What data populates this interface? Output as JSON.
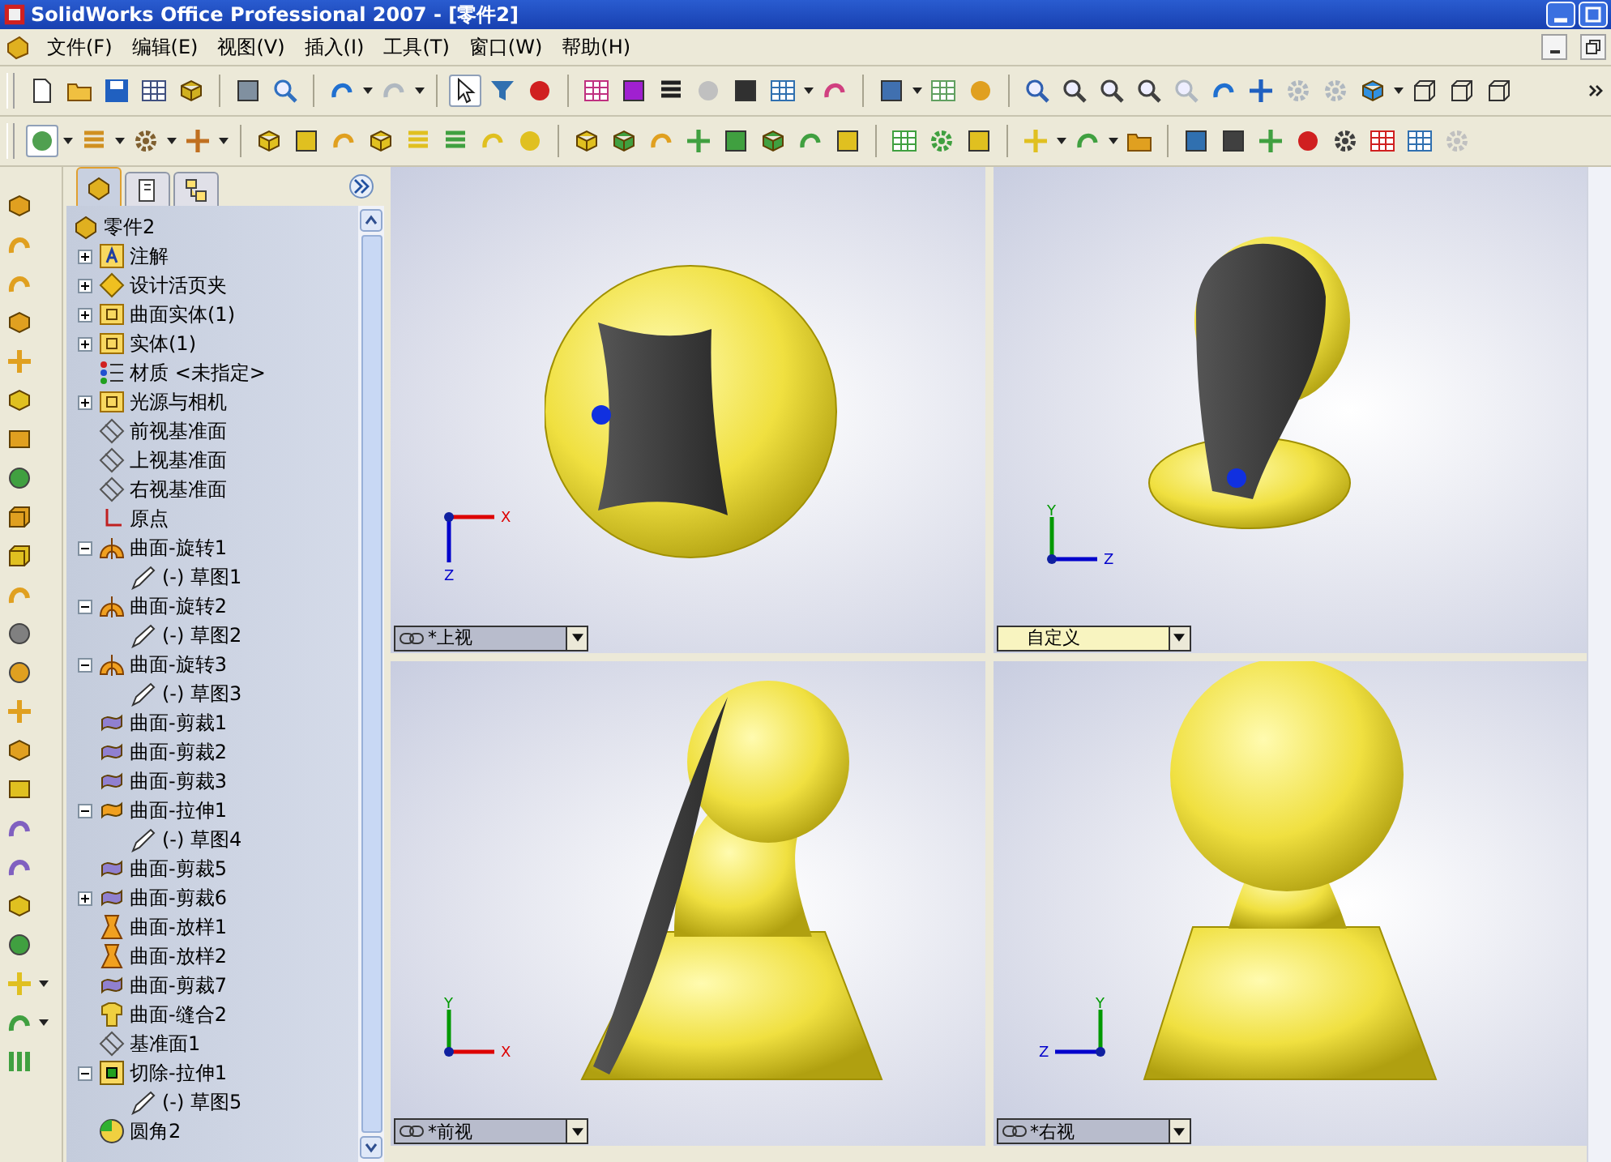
{
  "window": {
    "title": "SolidWorks Office Professional 2007 - [零件2]"
  },
  "menu": [
    "文件(F)",
    "编辑(E)",
    "视图(V)",
    "插入(I)",
    "工具(T)",
    "窗口(W)",
    "帮助(H)"
  ],
  "tree": {
    "tabs": [
      {
        "selected": true
      },
      {
        "selected": false
      },
      {
        "selected": false
      }
    ],
    "root": {
      "label": "零件2"
    },
    "items": [
      {
        "label": "注解",
        "kind": "annotation",
        "expanded": false
      },
      {
        "label": "设计活页夹",
        "kind": "binder",
        "expanded": false
      },
      {
        "label": "曲面实体(1)",
        "kind": "folder",
        "expanded": false
      },
      {
        "label": "实体(1)",
        "kind": "folder",
        "expanded": false
      },
      {
        "label": "材质 <未指定>",
        "kind": "material"
      },
      {
        "label": "光源与相机",
        "kind": "folder",
        "expanded": false
      },
      {
        "label": "前视基准面",
        "kind": "plane"
      },
      {
        "label": "上视基准面",
        "kind": "plane"
      },
      {
        "label": "右视基准面",
        "kind": "plane"
      },
      {
        "label": "原点",
        "kind": "origin"
      },
      {
        "label": "曲面-旋转1",
        "kind": "revolve",
        "expanded": true,
        "children": [
          {
            "label": "(-) 草图1",
            "kind": "sketch"
          }
        ]
      },
      {
        "label": "曲面-旋转2",
        "kind": "revolve",
        "expanded": true,
        "children": [
          {
            "label": "(-) 草图2",
            "kind": "sketch"
          }
        ]
      },
      {
        "label": "曲面-旋转3",
        "kind": "revolve",
        "expanded": true,
        "children": [
          {
            "label": "(-) 草图3",
            "kind": "sketch"
          }
        ]
      },
      {
        "label": "曲面-剪裁1",
        "kind": "trim"
      },
      {
        "label": "曲面-剪裁2",
        "kind": "trim"
      },
      {
        "label": "曲面-剪裁3",
        "kind": "trim"
      },
      {
        "label": "曲面-拉伸1",
        "kind": "extrude",
        "expanded": true,
        "children": [
          {
            "label": "(-) 草图4",
            "kind": "sketch"
          }
        ]
      },
      {
        "label": "曲面-剪裁5",
        "kind": "trim"
      },
      {
        "label": "曲面-剪裁6",
        "kind": "trim",
        "expanded": false
      },
      {
        "label": "曲面-放样1",
        "kind": "loft"
      },
      {
        "label": "曲面-放样2",
        "kind": "loft"
      },
      {
        "label": "曲面-剪裁7",
        "kind": "trim"
      },
      {
        "label": "曲面-缝合2",
        "kind": "knit"
      },
      {
        "label": "基准面1",
        "kind": "plane"
      },
      {
        "label": "切除-拉伸1",
        "kind": "cut",
        "expanded": true,
        "children": [
          {
            "label": "(-) 草图5",
            "kind": "sketch"
          }
        ]
      },
      {
        "label": "圆角2",
        "kind": "fillet"
      }
    ]
  },
  "viewports": [
    {
      "view": "*上视",
      "selected": false,
      "linked": true,
      "kind": "top",
      "axes": [
        {
          "label": "X",
          "color": "#dd0000"
        },
        {
          "label": "Z",
          "color": "#0000cc"
        }
      ]
    },
    {
      "view": "自定义",
      "selected": true,
      "linked": false,
      "kind": "iso",
      "axes": [
        {
          "label": "Y",
          "color": "#009900"
        },
        {
          "label": "Z",
          "color": "#0000cc"
        }
      ]
    },
    {
      "view": "*前视",
      "selected": false,
      "linked": true,
      "kind": "front",
      "axes": [
        {
          "label": "Y",
          "color": "#009900"
        },
        {
          "label": "X",
          "color": "#dd0000"
        }
      ]
    },
    {
      "view": "*右视",
      "selected": false,
      "linked": true,
      "kind": "right",
      "axes": [
        {
          "label": "Y",
          "color": "#009900"
        },
        {
          "label": "Z",
          "color": "#0000cc"
        }
      ]
    }
  ]
}
